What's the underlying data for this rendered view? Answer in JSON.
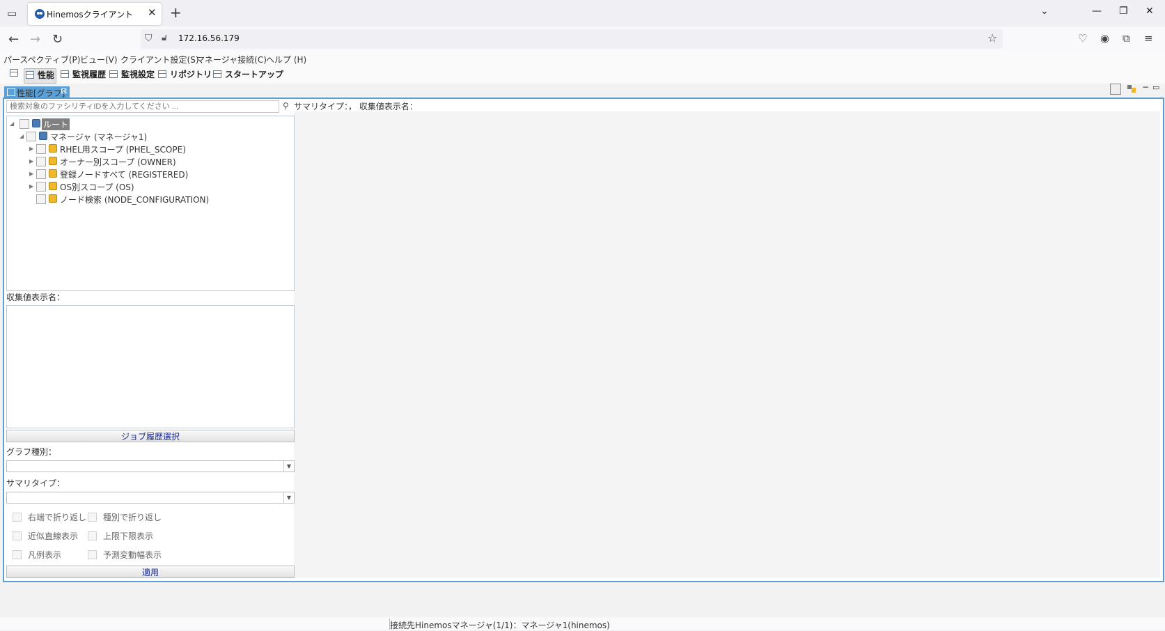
{
  "browser": {
    "tab_title": "Hinemosクライアント",
    "url": "172.16.56.179"
  },
  "menubar": {
    "items": [
      "パースペクティブ(P)",
      "ビュー(V)",
      "クライアント設定(S)",
      "マネージャ接続(C)",
      "ヘルプ (H)"
    ]
  },
  "perspectives": [
    "性能",
    "監視履歴",
    "監視設定",
    "リポジトリ",
    "スタートアップ"
  ],
  "view": {
    "tab_label": "性能[グラフ]",
    "search_placeholder": "検索対象のファシリティIDを入力してください ...",
    "summary_line": "サマリタイプ：， 収集値表示名：",
    "tree": {
      "root": "ルート",
      "manager": "マネージャ (マネージャ1)",
      "scopes": [
        "RHEL用スコープ (PHEL_SCOPE)",
        "オーナー別スコープ (OWNER)",
        "登録ノードすべて (REGISTERED)",
        "OS別スコープ (OS)",
        "ノード検索 (NODE_CONFIGURATION)"
      ]
    },
    "collect_label": "収集値表示名：",
    "job_history_button": "ジョブ履歴選択",
    "graph_type_label": "グラフ種別：",
    "summary_type_label": "サマリタイプ：",
    "checkboxes": {
      "wrap_right": "右端で折り返し",
      "wrap_type": "種別で折り返し",
      "approx_line": "近似直線表示",
      "limits": "上限下限表示",
      "legend": "凡例表示",
      "prediction": "予測変動幅表示"
    },
    "apply_button": "適用"
  },
  "status": {
    "text": "接続先Hinemosマネージャ(1/1)：マネージャ1(hinemos)"
  }
}
